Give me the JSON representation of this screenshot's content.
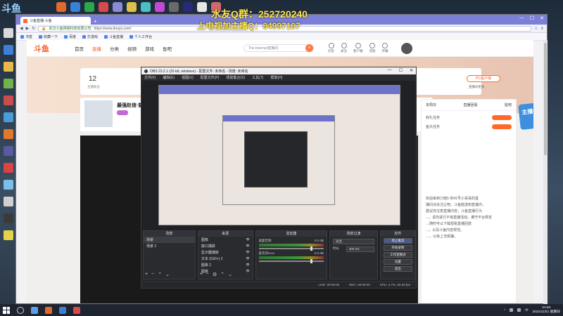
{
  "overlay": {
    "line1": "水友Q群：252720240",
    "line2": "上电视加主播Q：84997107"
  },
  "corner_logo": "斗鱼",
  "desktop_icons": [
    {
      "label": "",
      "color": "#d9d9d9"
    },
    {
      "label": "",
      "color": "#3f7fd6"
    },
    {
      "label": "",
      "color": "#e8b84a"
    },
    {
      "label": "",
      "color": "#6fb34a"
    },
    {
      "label": "",
      "color": "#c84e4e"
    },
    {
      "label": "",
      "color": "#4a9cd6"
    },
    {
      "label": "",
      "color": "#e07a2a"
    },
    {
      "label": "",
      "color": "#5a5aa0"
    },
    {
      "label": "",
      "color": "#d94444"
    },
    {
      "label": "",
      "color": "#7ac0e8"
    },
    {
      "label": "",
      "color": "#d0d0d0"
    },
    {
      "label": "",
      "color": "#3a3a3a"
    },
    {
      "label": "",
      "color": "#e6d24a"
    }
  ],
  "top_apps": [
    "#e06a2a",
    "#3c7fd6",
    "#2aa84a",
    "#d84a4a",
    "#8a8ad6",
    "#e0c04a",
    "#4ac0c0",
    "#c04ad6",
    "#6a6a6a",
    "#2a2a7a",
    "#e6e6e6",
    "#d06a6a"
  ],
  "browser": {
    "tab_title": "斗鱼直播-斗鱼",
    "new_tab": "+",
    "controls": [
      "—",
      "☐",
      "✕"
    ],
    "url_secure": "武汉斗鱼网络科技有限公司",
    "url_host": "https://www.douyu.com/",
    "bookmarks": [
      "书签",
      "收藏一下",
      "百度",
      "打游戏",
      "斗鱼直播",
      "个人工作台"
    ]
  },
  "site": {
    "logo": "斗鱼",
    "nav": [
      "首页",
      "直播",
      "分类",
      "视频",
      "游戏",
      "鱼吧"
    ],
    "search_placeholder": "The Internet直播间",
    "header_icons": [
      "历史",
      "关注",
      "客户端",
      "充值",
      "开播"
    ],
    "stat_num": "12",
    "stat_label": "主播粉丝",
    "pc_button": "PC客户端",
    "pc_sub": "直播间更多",
    "room_title": "最强赵信·新",
    "right_tabs": [
      "本周日",
      "直播回看",
      "贴吧"
    ],
    "right_rows": [
      "收礼任务",
      "鱼丸任务"
    ],
    "right_text": [
      "欢迎来到刀塔5·你41号小哥哥的直",
      "播间点关注让吧，斗鱼能送到直播内...",
      "建议你注意直播内容，斗鱼直播行为",
      "...，请勿进行不良直播活动，遵守平台规定",
      "…随时可以下载观看直播回放",
      "...，以及斗鱼内容规范。",
      "…，以免上当受骗。"
    ],
    "promo": "主播任务"
  },
  "obs": {
    "title": "OBS 23.2.1 (32-bit, windows) - 配置文件: 未命名 - 场景: 未命名",
    "menu": [
      "文件(F)",
      "编辑(E)",
      "视图(V)",
      "配置文件(P)",
      "场景集合(S)",
      "工具(T)",
      "帮助(H)"
    ],
    "docks": {
      "scenes": {
        "title": "场景",
        "items": [
          "场景",
          "场景 2"
        ]
      },
      "sources": {
        "title": "来源",
        "items": [
          "图像",
          "窗口捕获",
          "显示器捕获",
          "文本 (GDI+) 2",
          "图像 2",
          "图像"
        ]
      },
      "mixer": {
        "title": "混音器",
        "tracks": [
          {
            "name": "桌面音频",
            "db": "0.0 dB"
          },
          {
            "name": "麦克风/Aux",
            "db": "0.0 dB"
          }
        ]
      },
      "transitions": {
        "title": "场景过渡",
        "type": "淡出",
        "duration_label": "时长",
        "duration": "300 ms"
      },
      "controls": {
        "title": "控件",
        "buttons": [
          "停止推流",
          "开始录制",
          "工作室模式",
          "设置",
          "退出"
        ]
      }
    },
    "status": [
      "LIVE: 00:00:00",
      "REC: 00:00:00",
      "CPU: 2.7%, 60.00 fps"
    ]
  },
  "taskbar": {
    "apps": [
      "#5aa0e8",
      "#e06a2a",
      "#3c7fd6",
      "#d84a4a"
    ],
    "tray": [
      "^",
      "中"
    ],
    "time": "21:54",
    "date": "2021/11/21 星期日"
  }
}
